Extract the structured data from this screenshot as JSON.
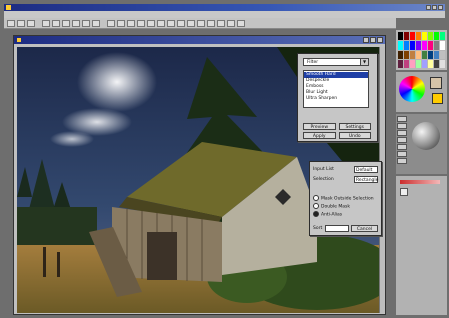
{
  "app": {
    "title": "",
    "menus": []
  },
  "document": {
    "title": ""
  },
  "filter_dialog": {
    "selected": "Filter",
    "items": [
      "Smooth Hard",
      "Despeckle",
      "Emboss",
      "Blur Light",
      "Ultra Sharpen"
    ],
    "selected_index": 0,
    "buttons": [
      "Preview",
      "Settings",
      "Apply",
      "Undo"
    ]
  },
  "settings_dialog": {
    "rows": [
      {
        "label": "Input List",
        "value": "Default"
      },
      {
        "label": "Selection",
        "value": "Rectangle"
      }
    ],
    "options": [
      "Mask Outside Selection",
      "Double Mask",
      "Anti-Alias"
    ],
    "checked_option": 2,
    "bottom_label": "Sort",
    "bottom_button": "Cancel"
  },
  "colors": {
    "foreground": "#d6c4a8",
    "background": "#ffcc00"
  }
}
